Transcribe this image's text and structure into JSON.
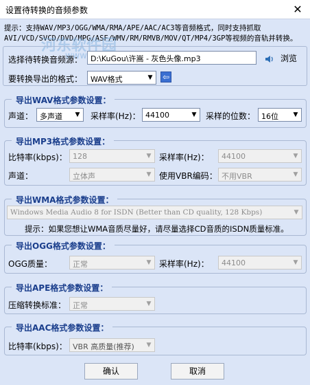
{
  "window": {
    "title": "设置待转换的音频参数",
    "close": "✕"
  },
  "tip": {
    "line1": "提示：支持WAV/MP3/OGG/WMA/RMA/APE/AAC/AC3等音频格式，同时支持抓取",
    "line2": "AVI/VCD/SVCD/DVD/MPG/ASF/WMV/RM/RMVB/MOV/QT/MP4/3GP等视频的音轨并转换。"
  },
  "watermark": {
    "brand": "河东软件园",
    "url": "www.pc0359.cn"
  },
  "source": {
    "label": "选择待转换音频源：",
    "path": "D:\\KuGou\\许嵩 - 灰色头像.mp3",
    "browse": "浏览",
    "format_label": "要转换导出的格式：",
    "format_value": "WAV格式"
  },
  "wav": {
    "legend": "导出WAV格式参数设置：",
    "channel_label": "声道：",
    "channel_value": "多声道",
    "rate_label": "采样率(Hz)：",
    "rate_value": "44100",
    "bits_label": "采样的位数：",
    "bits_value": "16位"
  },
  "mp3": {
    "legend": "导出MP3格式参数设置：",
    "bitrate_label": "比特率(kbps)：",
    "bitrate_value": "128",
    "rate_label": "采样率(Hz)：",
    "rate_value": "44100",
    "channel_label": "声道：",
    "channel_value": "立体声",
    "vbr_label": "使用VBR编码：",
    "vbr_value": "不用VBR"
  },
  "wma": {
    "legend": "导出WMA格式参数设置：",
    "profile_value": "Windows Media Audio 8 for ISDN (Better than CD quality, 128 Kbps)",
    "hint": "提示：如果您想让WMA音质尽量好，请尽量选择CD音质的ISDN质量标准。"
  },
  "ogg": {
    "legend": "导出OGG格式参数设置：",
    "quality_label": "OGG质量：",
    "quality_value": "正常",
    "rate_label": "采样率(Hz)：",
    "rate_value": "44100"
  },
  "ape": {
    "legend": "导出APE格式参数设置：",
    "level_label": "压缩转换标准：",
    "level_value": "正常"
  },
  "aac": {
    "legend": "导出AAC格式参数设置：",
    "bitrate_label": "比特率(kbps)：",
    "bitrate_value": "VBR 高质量(推荐)"
  },
  "buttons": {
    "ok": "确认",
    "cancel": "取消"
  },
  "icons": {
    "dropdown": "▼",
    "back": "⇦"
  }
}
